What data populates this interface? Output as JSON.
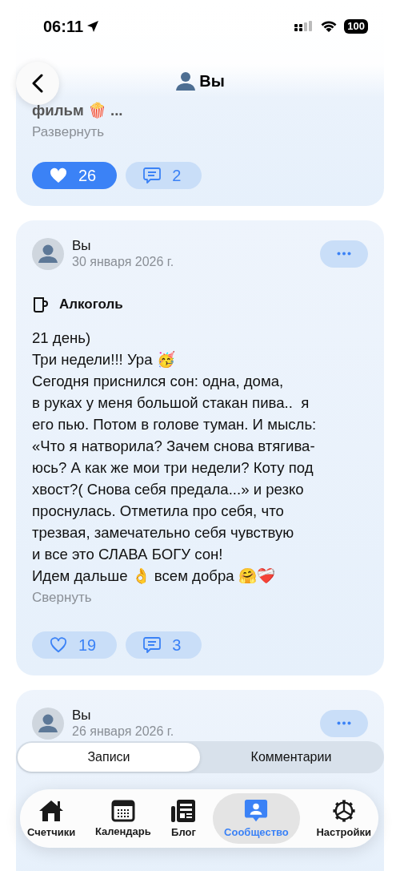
{
  "status_bar": {
    "time": "06:11",
    "battery": "100"
  },
  "header": {
    "title": "Вы"
  },
  "posts": [
    {
      "text_lines": [
        "фильм 🍿 ..."
      ],
      "toggle": "Развернуть",
      "likes": "26",
      "liked": true,
      "comments": "2"
    },
    {
      "author": "Вы",
      "date": "30 января 2026 г.",
      "category": "Алкоголь",
      "text_lines": [
        "21 день)",
        "Три недели!!! Ура 🥳",
        "Сегодня приснился сон: одна, дома,",
        "в руках у меня большой стакан пива..  я",
        "его пью. Потом в голове туман. И мысль:",
        "«Что я натворила? Зачем снова втягива-",
        "юсь? А как же мои три недели? Коту под",
        "хвост?( Снова себя предала...» и резко",
        "проснулась. Отметила про себя, что",
        "трезвая, замечательно себя чувствую",
        "и все это СЛАВА БОГУ сон!",
        "Идем дальше 👌 всем добра 🤗❤️‍🩹"
      ],
      "toggle": "Свернуть",
      "likes": "19",
      "liked": false,
      "comments": "3"
    },
    {
      "author": "Вы",
      "date": "26 января 2026 г."
    }
  ],
  "segments": [
    {
      "label": "Записи",
      "selected": true
    },
    {
      "label": "Комментарии",
      "selected": false
    }
  ],
  "tab_bar": [
    {
      "label": "Счетчики",
      "kind": "home",
      "selected": false
    },
    {
      "label": "Календарь",
      "kind": "calendar",
      "selected": false
    },
    {
      "label": "Блог",
      "kind": "news",
      "selected": false
    },
    {
      "label": "Сообщество",
      "kind": "community",
      "selected": true
    },
    {
      "label": "Настройки",
      "kind": "gear",
      "selected": false
    }
  ]
}
